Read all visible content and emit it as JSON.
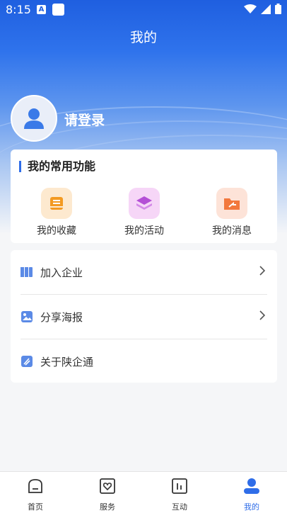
{
  "status_bar": {
    "time": "8:15",
    "a_badge": "A"
  },
  "header": {
    "title": "我的"
  },
  "profile": {
    "login_text": "请登录"
  },
  "functions": {
    "title": "我的常用功能",
    "items": [
      {
        "label": "我的收藏",
        "icon": "collection-icon",
        "bg": "#fde9cf",
        "color": "#f39a22"
      },
      {
        "label": "我的活动",
        "icon": "activity-icon",
        "bg": "#f6d6f7",
        "color": "#b44fd6"
      },
      {
        "label": "我的消息",
        "icon": "message-icon",
        "bg": "#fde3d8",
        "color": "#f2783d"
      }
    ]
  },
  "menu": {
    "items": [
      {
        "label": "加入企业",
        "icon": "building-icon",
        "has_arrow": true
      },
      {
        "label": "分享海报",
        "icon": "image-icon",
        "has_arrow": true
      },
      {
        "label": "关于陕企通",
        "icon": "about-icon",
        "has_arrow": false
      }
    ]
  },
  "tabbar": {
    "tabs": [
      {
        "label": "首页",
        "icon": "home-icon",
        "active": false
      },
      {
        "label": "服务",
        "icon": "heart-icon",
        "active": false
      },
      {
        "label": "互动",
        "icon": "chart-icon",
        "active": false
      },
      {
        "label": "我的",
        "icon": "user-icon",
        "active": true
      }
    ]
  },
  "colors": {
    "accent": "#2f6de8",
    "header_top": "#1f5fe0"
  }
}
